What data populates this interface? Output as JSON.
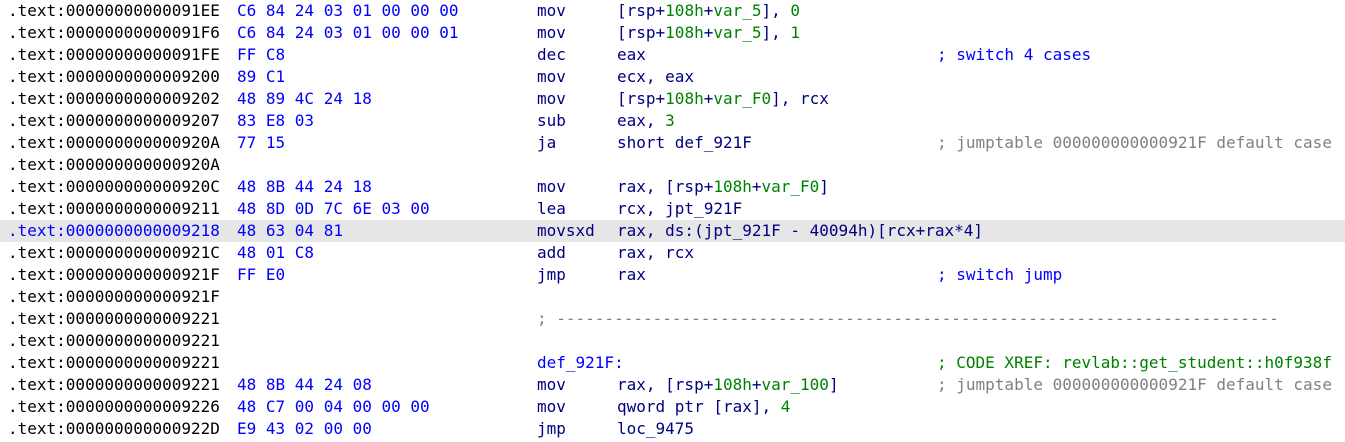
{
  "rows": [
    {
      "addr": ".text:00000000000091EE",
      "bytes": "C6 84 24 03 01 00 00 00",
      "mnem": "mov",
      "ops": [
        "[rsp+",
        "108h",
        "+",
        "var_5",
        "], ",
        "0"
      ],
      "cmt": ""
    },
    {
      "addr": ".text:00000000000091F6",
      "bytes": "C6 84 24 03 01 00 00 01",
      "mnem": "mov",
      "ops": [
        "[rsp+",
        "108h",
        "+",
        "var_5",
        "], ",
        "1"
      ],
      "cmt": ""
    },
    {
      "addr": ".text:00000000000091FE",
      "bytes": "FF C8",
      "mnem": "dec",
      "ops": [
        "eax",
        "",
        "",
        "",
        "",
        ""
      ],
      "cmt": "; switch 4 cases"
    },
    {
      "addr": ".text:0000000000009200",
      "bytes": "89 C1",
      "mnem": "mov",
      "ops": [
        "ecx, eax",
        "",
        "",
        "",
        "",
        ""
      ],
      "cmt": ""
    },
    {
      "addr": ".text:0000000000009202",
      "bytes": "48 89 4C 24 18",
      "mnem": "mov",
      "ops": [
        "[rsp+",
        "108h",
        "+",
        "var_F0",
        "], rcx",
        ""
      ],
      "cmt": ""
    },
    {
      "addr": ".text:0000000000009207",
      "bytes": "83 E8 03",
      "mnem": "sub",
      "ops": [
        "eax, ",
        "",
        "",
        "",
        "",
        "3"
      ],
      "cmt": ""
    },
    {
      "addr": ".text:000000000000920A",
      "bytes": "77 15",
      "mnem": "ja",
      "ops": [
        "short def_921F",
        "",
        "",
        "",
        "",
        ""
      ],
      "cmt": "; jumptable 000000000000921F default case"
    },
    {
      "addr": ".text:000000000000920A",
      "bytes": "",
      "mnem": "",
      "ops": [
        "",
        "",
        "",
        "",
        "",
        ""
      ],
      "cmt": ""
    },
    {
      "addr": ".text:000000000000920C",
      "bytes": "48 8B 44 24 18",
      "mnem": "mov",
      "ops": [
        "rax, [rsp+",
        "108h",
        "+",
        "var_F0",
        "]",
        ""
      ],
      "cmt": ""
    },
    {
      "addr": ".text:0000000000009211",
      "bytes": "48 8D 0D 7C 6E 03 00",
      "mnem": "lea",
      "ops": [
        "rcx, jpt_921F",
        "",
        "",
        "",
        "",
        ""
      ],
      "cmt": ""
    },
    {
      "addr": ".text:0000000000009218",
      "bytes": "48 63 04 81",
      "mnem": "movsxd",
      "ops": [
        "rax, ds:(jpt_921F - 40094h)[rcx+rax*4]",
        "",
        "",
        "",
        "",
        ""
      ],
      "cmt": "",
      "hl": true
    },
    {
      "addr": ".text:000000000000921C",
      "bytes": "48 01 C8",
      "mnem": "add",
      "ops": [
        "rax, rcx",
        "",
        "",
        "",
        "",
        ""
      ],
      "cmt": ""
    },
    {
      "addr": ".text:000000000000921F",
      "bytes": "FF E0",
      "mnem": "jmp",
      "ops": [
        "rax",
        "",
        "",
        "",
        "",
        ""
      ],
      "cmt": "; switch jump"
    },
    {
      "addr": ".text:000000000000921F",
      "bytes": "",
      "mnem": "",
      "ops": [
        "",
        "",
        "",
        "",
        "",
        ""
      ],
      "cmt": ""
    },
    {
      "addr": ".text:0000000000009221",
      "bytes": "",
      "mnem": "",
      "ops": [
        "",
        "",
        "",
        "",
        "",
        ""
      ],
      "cmt": "",
      "sep": "; ---------------------------------------------------------------------------"
    },
    {
      "addr": ".text:0000000000009221",
      "bytes": "",
      "mnem": "",
      "ops": [
        "",
        "",
        "",
        "",
        "",
        ""
      ],
      "cmt": ""
    },
    {
      "addr": ".text:0000000000009221",
      "bytes": "",
      "mnem": "",
      "ops": [
        "",
        "",
        "",
        "",
        "",
        ""
      ],
      "cmt": "; CODE XREF: revlab::get_student::h0f938f",
      "label": "def_921F:",
      "cmtclass": "green"
    },
    {
      "addr": ".text:0000000000009221",
      "bytes": "48 8B 44 24 08",
      "mnem": "mov",
      "ops": [
        "rax, [rsp+",
        "108h",
        "+",
        "var_100",
        "]",
        ""
      ],
      "cmt": "; jumptable 000000000000921F default case"
    },
    {
      "addr": ".text:0000000000009226",
      "bytes": "48 C7 00 04 00 00 00",
      "mnem": "mov",
      "ops": [
        "qword ptr [rax], ",
        "",
        "",
        "",
        "",
        "4"
      ],
      "cmt": ""
    },
    {
      "addr": ".text:000000000000922D",
      "bytes": "E9 43 02 00 00",
      "mnem": "jmp",
      "ops": [
        "loc_9475",
        "",
        "",
        "",
        "",
        ""
      ],
      "cmt": ""
    }
  ],
  "colors": {
    "background": "#ffffff",
    "highlight": "#e6e6e6",
    "bytes": "#0000ff",
    "mnemonic": "#000080",
    "immediate": "#008000",
    "comment": "#0000ff",
    "comment_gray": "#808080"
  }
}
